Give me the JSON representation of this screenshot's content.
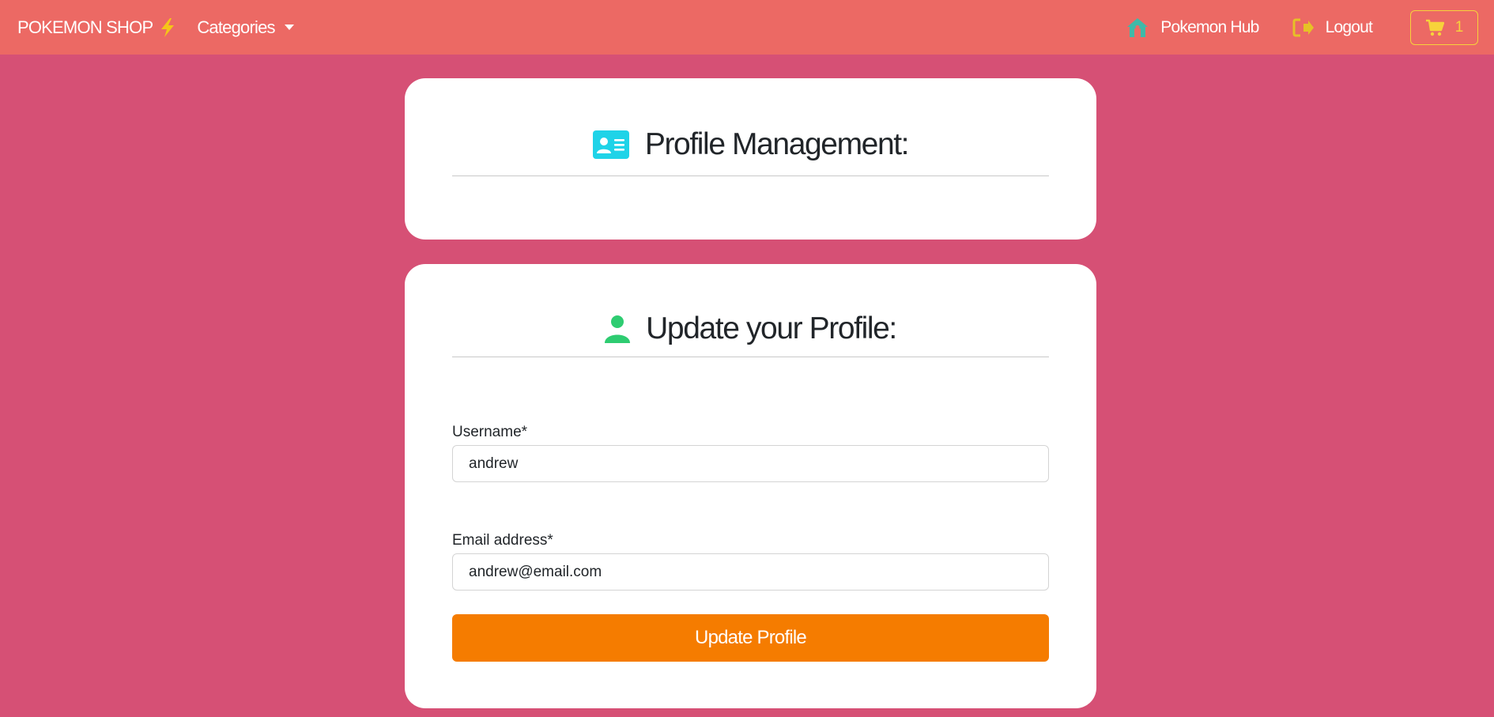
{
  "navbar": {
    "brand": "POKEMON SHOP",
    "brand_icon": "lightning-bolt-icon",
    "categories_label": "Categories",
    "hub_label": "Pokemon Hub",
    "hub_icon": "house-icon",
    "logout_label": "Logout",
    "logout_icon": "sign-out-icon",
    "cart_count": "1",
    "cart_icon": "cart-icon",
    "colors": {
      "background": "#ec6964",
      "hub_icon": "#3fb9a8",
      "logout_icon": "#e6c126",
      "cart": "#f7d23b",
      "bolt": "#f5c518"
    }
  },
  "page": {
    "background": "#d65075"
  },
  "profile_card": {
    "title": "Profile Management:",
    "icon": "id-card-icon",
    "icon_color": "#1fd3e8"
  },
  "update_card": {
    "title": "Update your Profile:",
    "icon": "user-icon",
    "icon_color": "#2ecc71",
    "fields": {
      "username": {
        "label": "Username*",
        "value": "andrew"
      },
      "email": {
        "label": "Email address*",
        "value": "andrew@email.com"
      }
    },
    "submit_label": "Update Profile",
    "submit_color": "#f57c00"
  }
}
